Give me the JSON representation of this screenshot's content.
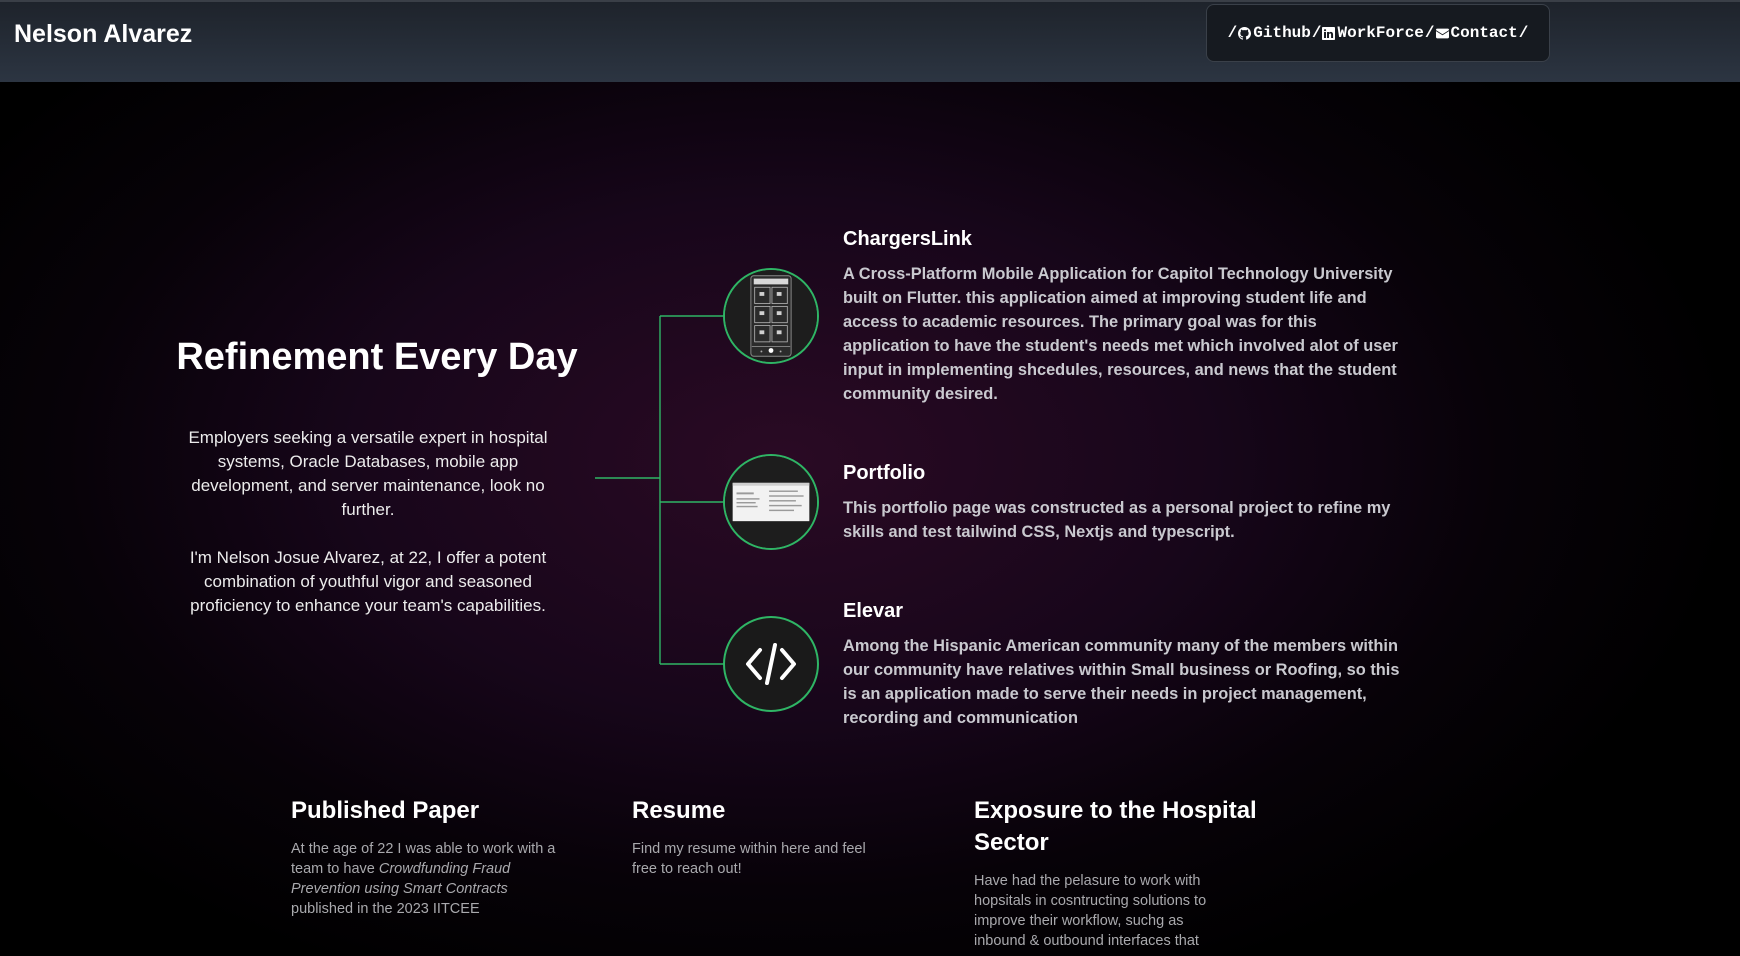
{
  "header": {
    "brand": "Nelson Alvarez",
    "nav": {
      "prefix": "/",
      "sep": "/",
      "items": [
        {
          "label": "Github",
          "icon": "github-icon"
        },
        {
          "label": "WorkForce",
          "icon": "linkedin-icon"
        },
        {
          "label": "Contact",
          "icon": "mail-icon"
        }
      ]
    }
  },
  "hero": {
    "title": "Refinement Every Day",
    "p1": "Employers seeking a versatile expert in hospital systems, Oracle Databases, mobile app development, and server maintenance, look no further.",
    "p2": "I'm Nelson Josue Alvarez, at 22, I offer a potent combination of youthful vigor and seasoned proficiency to enhance your team's capabilities."
  },
  "projects": [
    {
      "title": "ChargersLink",
      "description": "A Cross-Platform Mobile Application for Capitol Technology University built on Flutter. this application aimed at improving student life and access to academic resources. The primary goal was for this application to have the student's needs met which involved alot of user input in implementing shcedules, resources, and news that the student community desired.",
      "thumb": "phone-app-thumbnail"
    },
    {
      "title": "Portfolio",
      "description": "This portfolio page was constructed as a personal project to refine my skills and test tailwind CSS, Nextjs and typescript.",
      "thumb": "website-thumbnail"
    },
    {
      "title": "Elevar",
      "description": "Among the Hispanic American community many of the members within our community have relatives within Small business or Roofing, so this is an application made to serve their needs in project management, recording and communication",
      "thumb": "code-icon"
    }
  ],
  "cards": {
    "paper": {
      "title": "Published Paper",
      "text_before": "At the age of 22 I was able to work with a team to have ",
      "text_italic": "Crowdfunding Fraud Prevention using Smart Contracts",
      "text_after": " published in the 2023 IITCEE"
    },
    "resume": {
      "title": "Resume",
      "text": "Find my resume within here and feel free to reach out!"
    },
    "hospital": {
      "title": "Exposure to the Hospital Sector",
      "text": "Have had the pelasure to work with hopsitals in cosntructing solutions to improve their workflow, suchg as inbound & outbound interfaces that"
    }
  },
  "colors": {
    "accent_green": "#2fb565",
    "header_bg": "#2c3542",
    "background": "#000000"
  }
}
